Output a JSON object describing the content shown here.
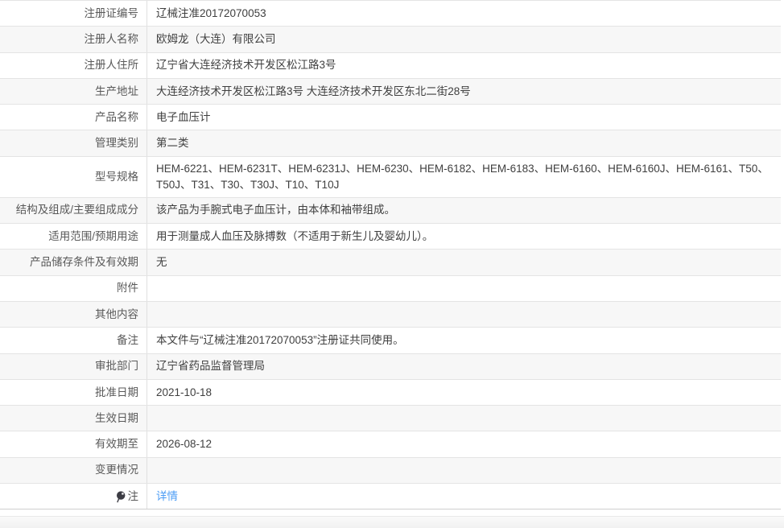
{
  "colors": {
    "link": "#4b9cf5",
    "stripe_row_bg": "#f7f7f7",
    "border": "#e4e4e4",
    "label_text": "#595959",
    "value_text": "#3f3f3f"
  },
  "table": {
    "rows": [
      {
        "label": "注册证编号",
        "value": "辽械注准20172070053"
      },
      {
        "label": "注册人名称",
        "value": "欧姆龙（大连）有限公司"
      },
      {
        "label": "注册人住所",
        "value": "辽宁省大连经济技术开发区松江路3号"
      },
      {
        "label": "生产地址",
        "value": "大连经济技术开发区松江路3号 大连经济技术开发区东北二街28号"
      },
      {
        "label": "产品名称",
        "value": "电子血压计"
      },
      {
        "label": "管理类别",
        "value": "第二类"
      },
      {
        "label": "型号规格",
        "value": "HEM-6221、HEM-6231T、HEM-6231J、HEM-6230、HEM-6182、HEM-6183、HEM-6160、HEM-6160J、HEM-6161、T50、T50J、T31、T30、T30J、T10、T10J"
      },
      {
        "label": "结构及组成/主要组成成分",
        "value": "该产品为手腕式电子血压计，由本体和袖带组成。"
      },
      {
        "label": "适用范围/预期用途",
        "value": "用于测量成人血压及脉搏数（不适用于新生儿及婴幼儿）。"
      },
      {
        "label": "产品储存条件及有效期",
        "value": "无"
      },
      {
        "label": "附件",
        "value": ""
      },
      {
        "label": "其他内容",
        "value": ""
      },
      {
        "label": "备注",
        "value": "本文件与“辽械注准20172070053”注册证共同使用。"
      },
      {
        "label": "审批部门",
        "value": "辽宁省药品监督管理局"
      },
      {
        "label": "批准日期",
        "value": "2021-10-18"
      },
      {
        "label": "生效日期",
        "value": ""
      },
      {
        "label": "有效期至",
        "value": "2026-08-12"
      },
      {
        "label": "变更情况",
        "value": ""
      },
      {
        "label": "注",
        "value": "详情",
        "icon": "balloon-note-icon"
      }
    ]
  }
}
